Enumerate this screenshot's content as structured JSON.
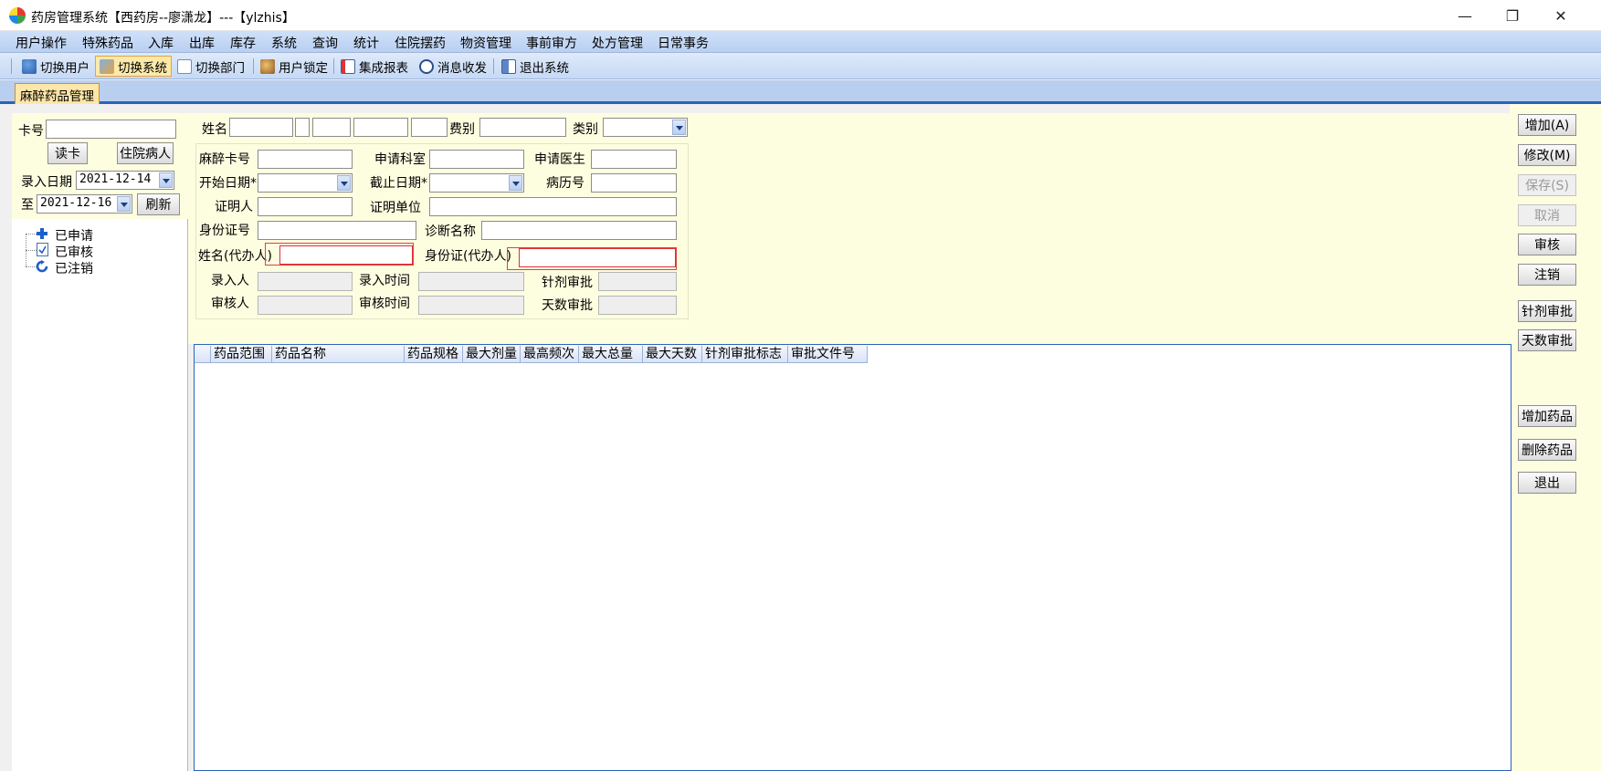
{
  "window": {
    "title": "药房管理系统【西药房--廖潇龙】---【ylzhis】",
    "minimize_glyph": "—",
    "restore_glyph": "❐",
    "close_glyph": "✕"
  },
  "menu": [
    "用户操作",
    "特殊药品",
    "入库",
    "出库",
    "库存",
    "系统",
    "查询",
    "统计",
    "住院摆药",
    "物资管理",
    "事前审方",
    "处方管理",
    "日常事务"
  ],
  "toolbar": [
    {
      "label": "切换用户",
      "icon": "switch-user-icon",
      "active": false
    },
    {
      "label": "切换系统",
      "icon": "switch-system-icon",
      "active": true
    },
    {
      "label": "切换部门",
      "icon": "switch-department-icon",
      "active": false
    },
    {
      "label": "用户锁定",
      "icon": "user-lock-icon",
      "active": false
    },
    {
      "label": "集成报表",
      "icon": "report-icon",
      "active": false
    },
    {
      "label": "消息收发",
      "icon": "message-icon",
      "active": false
    },
    {
      "label": "退出系统",
      "icon": "exit-icon",
      "active": false
    }
  ],
  "tab": {
    "label": "麻醉药品管理"
  },
  "left": {
    "card_label": "卡号",
    "card_value": "",
    "read_card": "读卡",
    "inpatient": "住院病人",
    "entry_date_label": "录入日期",
    "date_from": "2021-12-14",
    "to_label": "至",
    "date_to": "2021-12-16",
    "refresh": "刷新",
    "tree": [
      {
        "label": "已申请",
        "icon": "plus-icon"
      },
      {
        "label": "已审核",
        "icon": "document-check-icon"
      },
      {
        "label": "已注销",
        "icon": "cancel-refresh-icon"
      }
    ]
  },
  "form": {
    "name_label": "姓名",
    "fee_label": "费别",
    "category_label": "类别",
    "anes_card_label": "麻醉卡号",
    "apply_dept_label": "申请科室",
    "apply_doctor_label": "申请医生",
    "start_date_label": "开始日期*",
    "end_date_label": "截止日期*",
    "record_no_label": "病历号",
    "witness_label": "证明人",
    "witness_unit_label": "证明单位",
    "id_no_label": "身份证号",
    "diagnosis_label": "诊断名称",
    "agent_name_label": "姓名(代办人)",
    "agent_id_label": "身份证(代办人)",
    "entry_person_label": "录入人",
    "entry_time_label": "录入时间",
    "dose_approve_label": "针剂审批",
    "auditor_label": "审核人",
    "audit_time_label": "审核时间",
    "days_approve_label": "天数审批"
  },
  "right_buttons": {
    "add": "增加(A)",
    "modify": "修改(M)",
    "save": "保存(S)",
    "cancel": "取消",
    "audit": "审核",
    "void": "注销",
    "dose_approve": "针剂审批",
    "days_approve": "天数审批",
    "add_drug": "增加药品",
    "delete_drug": "删除药品",
    "exit": "退出"
  },
  "grid": {
    "columns": [
      "药品范围",
      "药品名称",
      "药品规格",
      "最大剂量",
      "最高频次",
      "最大总量",
      "最大天数",
      "针剂审批标志",
      "审批文件号"
    ],
    "rows": []
  }
}
